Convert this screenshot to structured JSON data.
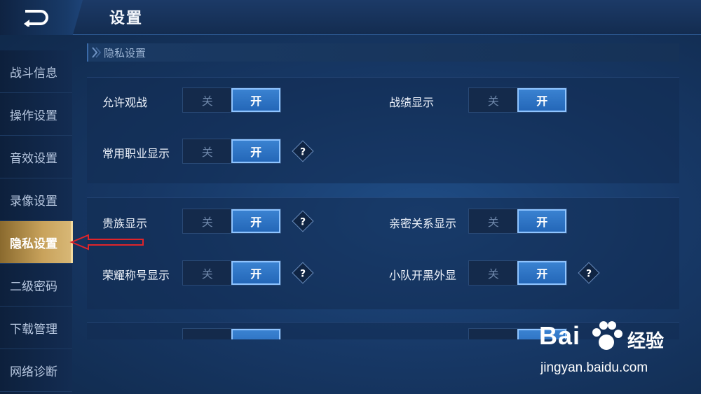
{
  "header": {
    "title": "设置"
  },
  "sidebar": {
    "items": [
      {
        "label": "战斗信息",
        "active": false
      },
      {
        "label": "操作设置",
        "active": false
      },
      {
        "label": "音效设置",
        "active": false
      },
      {
        "label": "录像设置",
        "active": false
      },
      {
        "label": "隐私设置",
        "active": true
      },
      {
        "label": "二级密码",
        "active": false
      },
      {
        "label": "下载管理",
        "active": false
      },
      {
        "label": "网络诊断",
        "active": false
      }
    ]
  },
  "section": {
    "title": "隐私设置"
  },
  "toggle": {
    "off_label": "关",
    "on_label": "开"
  },
  "help_label": "?",
  "settings": {
    "allow_spectate": {
      "label": "允许观战",
      "state": "开"
    },
    "stats_display": {
      "label": "战绩显示",
      "state": "开"
    },
    "role_display": {
      "label": "常用职业显示",
      "state": "开"
    },
    "noble_display": {
      "label": "贵族显示",
      "state": "开"
    },
    "intimacy_display": {
      "label": "亲密关系显示",
      "state": "开"
    },
    "honor_title_display": {
      "label": "荣耀称号显示",
      "state": "开"
    },
    "team_smurf_display": {
      "label": "小队开黑外显",
      "state": "开"
    }
  },
  "watermark": {
    "brand": "Bai",
    "brand_suffix": "经验",
    "url": "jingyan.baidu.com"
  },
  "colors": {
    "accent": "#2467b8",
    "active_tab": "#c9a35c",
    "background": "#173866",
    "annotation_arrow": "#e0242a"
  }
}
